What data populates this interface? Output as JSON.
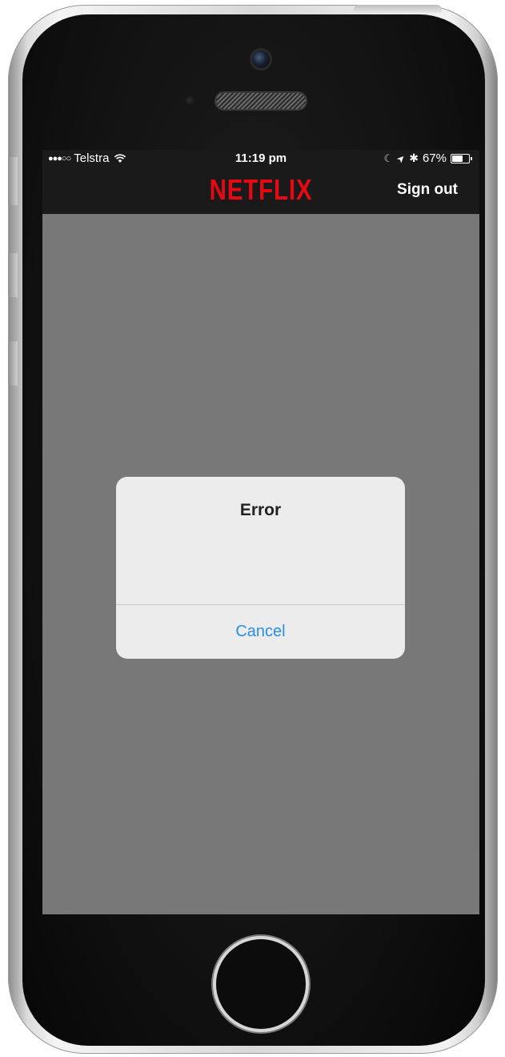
{
  "status_bar": {
    "signal": "●●●○○",
    "carrier": "Telstra",
    "time": "11:19 pm",
    "moon_glyph": "☾",
    "location_glyph": "➤",
    "bluetooth_glyph": "✱",
    "battery_percent": "67%",
    "battery_level": 0.67
  },
  "nav": {
    "logo_text": "NETFLIX",
    "sign_out_label": "Sign out"
  },
  "alert": {
    "title": "Error",
    "cancel_label": "Cancel"
  },
  "colors": {
    "brand_red": "#e50914",
    "ios_link_blue": "#2a8ee0",
    "overlay_gray": "#787878",
    "nav_background": "#1a1a1a"
  },
  "icons": {
    "wifi": "wifi-icon",
    "battery": "battery-icon",
    "moon": "moon-icon",
    "location": "location-arrow-icon",
    "bluetooth": "bluetooth-icon"
  }
}
